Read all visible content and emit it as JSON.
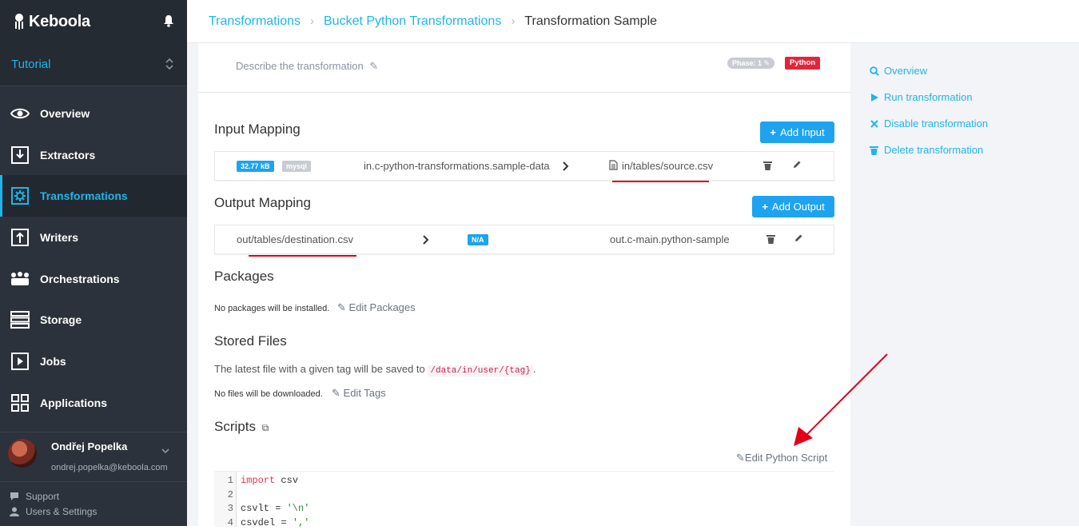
{
  "brand": {
    "name": "Keboola"
  },
  "project": {
    "name": "Tutorial"
  },
  "nav": [
    {
      "label": "Overview",
      "icon": "eye-icon"
    },
    {
      "label": "Extractors",
      "icon": "download-icon"
    },
    {
      "label": "Transformations",
      "icon": "gear-icon",
      "active": true
    },
    {
      "label": "Writers",
      "icon": "upload-icon"
    },
    {
      "label": "Orchestrations",
      "icon": "orchestration-icon"
    },
    {
      "label": "Storage",
      "icon": "storage-icon"
    },
    {
      "label": "Jobs",
      "icon": "play-icon"
    },
    {
      "label": "Applications",
      "icon": "grid-icon"
    }
  ],
  "user": {
    "name": "Ondřej Popelka",
    "email": "ondrej.popelka@keboola.com"
  },
  "footer": {
    "support": "Support",
    "settings": "Users & Settings"
  },
  "breadcrumb": {
    "items": [
      "Transformations",
      "Bucket Python Transformations"
    ],
    "current": "Transformation Sample"
  },
  "transformation": {
    "description_placeholder": "Describe the transformation",
    "phase_badge": "Phase: 1",
    "backend_badge": "Python"
  },
  "input_mapping": {
    "title": "Input Mapping",
    "add_label": "Add Input",
    "row": {
      "size": "32.77 kB",
      "db": "mysql",
      "source": "in.c-python-transformations.sample-data",
      "destination": "in/tables/source.csv"
    }
  },
  "output_mapping": {
    "title": "Output Mapping",
    "add_label": "Add Output",
    "row": {
      "source": "out/tables/destination.csv",
      "badge": "N/A",
      "destination": "out.c-main.python-sample"
    }
  },
  "packages": {
    "title": "Packages",
    "empty_text": "No packages will be installed.",
    "edit_label": "Edit Packages"
  },
  "stored_files": {
    "title": "Stored Files",
    "info_prefix": "The latest file with a given tag will be saved to",
    "info_path": "/data/in/user/{tag}",
    "info_suffix": ".",
    "empty_text": "No files will be downloaded.",
    "edit_label": "Edit Tags"
  },
  "scripts": {
    "title": "Scripts",
    "edit_label": "Edit Python Script",
    "lines": [
      {
        "n": "1",
        "kw": "import",
        "rest": " csv"
      },
      {
        "n": "2",
        "kw": "",
        "rest": ""
      },
      {
        "n": "3",
        "kw": "",
        "rest": "csvlt = ",
        "str": "'\\n'"
      },
      {
        "n": "4",
        "kw": "",
        "rest": "csvdel = ",
        "str": "','"
      }
    ]
  },
  "actions": {
    "overview": "Overview",
    "run": "Run transformation",
    "disable": "Disable transformation",
    "delete": "Delete transformation"
  },
  "colors": {
    "accent": "#1fb5ea",
    "sidebar": "#2b323b",
    "python_badge": "#e0263a",
    "annotation": "#e1001a"
  }
}
